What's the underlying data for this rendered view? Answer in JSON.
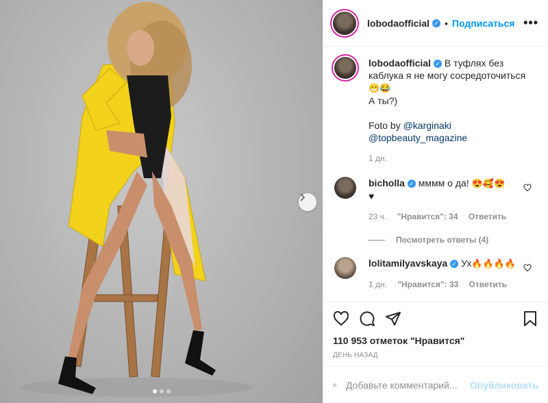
{
  "post": {
    "author": "lobodaofficial",
    "follow_label": "Подписаться",
    "separator": "•",
    "more_label": "•••",
    "caption_line1": "В туфлях без каблука я не могу сосредоточиться",
    "caption_emoji": "😁😂",
    "caption_line2": "А ты?)",
    "credit_prefix": "Foto by",
    "credit_mention1": "@karginaki",
    "credit_mention2": "@topbeauty_magazine",
    "caption_time": "1 дн."
  },
  "comments": [
    {
      "user": "bicholla",
      "text": "мммм о да!",
      "emoji": "😍🥰😍",
      "extra": "♥",
      "time": "23 ч.",
      "likes": "\"Нравится\": 34",
      "reply": "Ответить"
    },
    {
      "user": "lolitamilyavskaya",
      "text": "Ух",
      "emoji": "🔥🔥🔥🔥",
      "time": "1 дн.",
      "likes": "\"Нравится\": 33",
      "reply": "Ответить"
    }
  ],
  "view_replies": "Посмотреть ответы (4)",
  "likes_count": "110 953 отметок \"Нравится\"",
  "post_date": "день назад",
  "add_comment": {
    "placeholder": "Добавьте комментарий...",
    "publish": "Опубликовать"
  },
  "carousel": {
    "count": 3,
    "active": 1
  },
  "colors": {
    "accent": "#0095f6",
    "coat": "#f2d21b",
    "verified": "#3897f0"
  },
  "icons": [
    "verified-icon",
    "heart-icon",
    "comment-icon",
    "share-icon",
    "bookmark-icon",
    "emoji-icon",
    "chevron-right-icon",
    "more-icon"
  ]
}
